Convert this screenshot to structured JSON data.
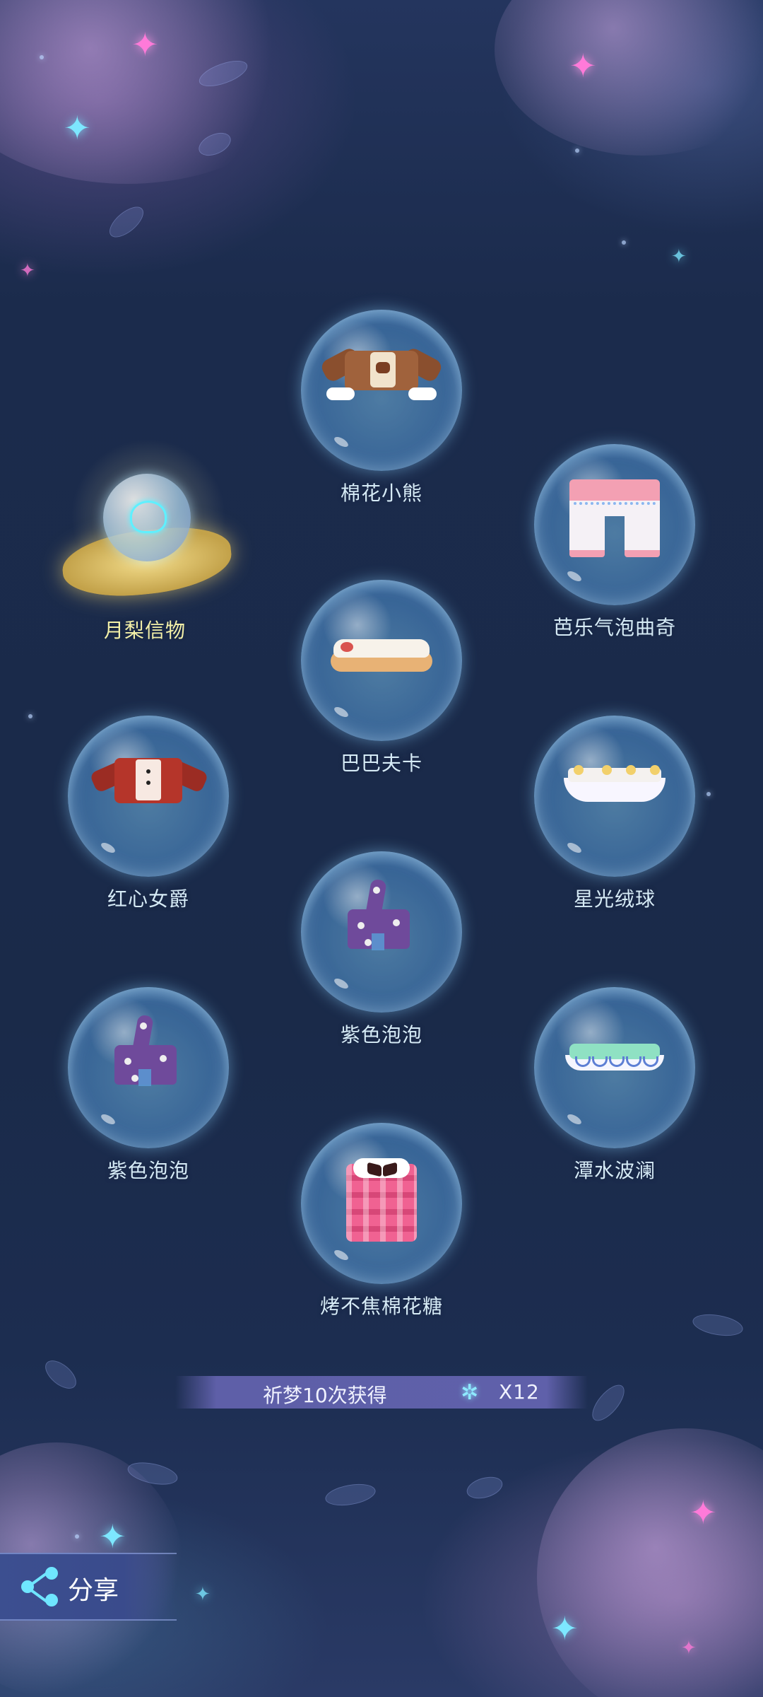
{
  "items": [
    {
      "name": "棉花小熊"
    },
    {
      "name": "芭乐气泡曲奇"
    },
    {
      "name": "巴巴夫卡"
    },
    {
      "name": "红心女爵"
    },
    {
      "name": "星光绒球"
    },
    {
      "name": "紫色泡泡"
    },
    {
      "name": "紫色泡泡"
    },
    {
      "name": "潭水波澜"
    },
    {
      "name": "烤不焦棉花糖"
    }
  ],
  "special_item": {
    "name": "月梨信物"
  },
  "banner": {
    "text": "祈梦10次获得",
    "count": "X12"
  },
  "share": {
    "label": "分享"
  },
  "colors": {
    "label": "#d6ebf6",
    "special_label": "#f3f0a8",
    "banner": "#5f60aa",
    "accent": "#6fe6ff"
  }
}
